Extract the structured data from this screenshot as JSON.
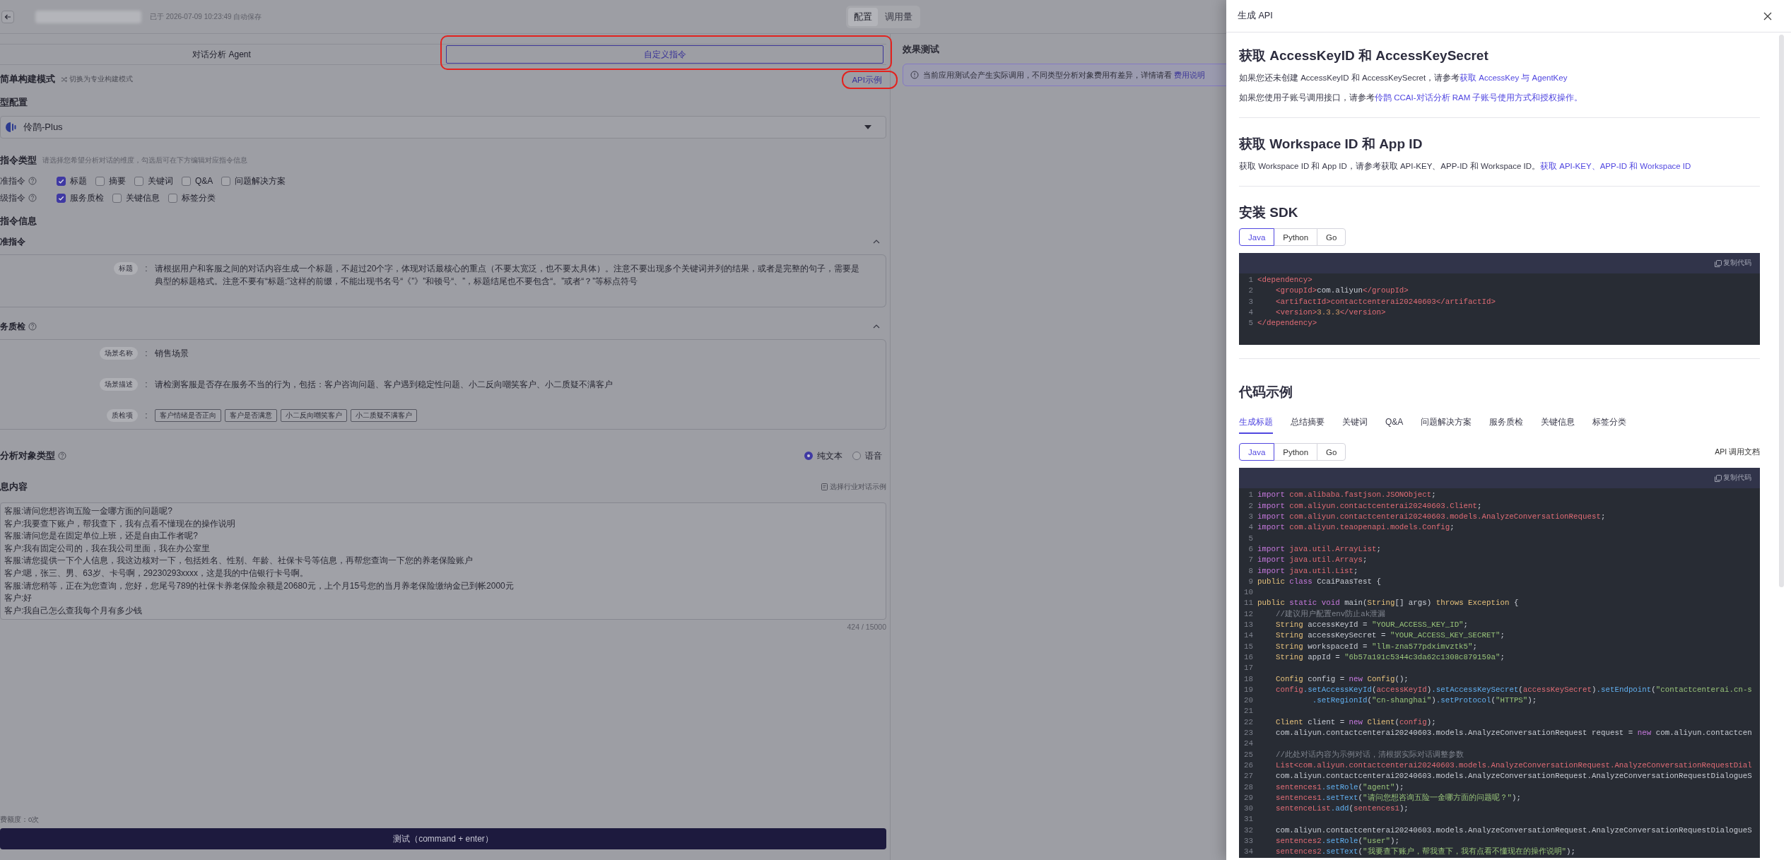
{
  "header": {
    "saved_note": "已于 2026-07-09 10:23:49 自动保存",
    "view_switch": [
      {
        "label": "配置",
        "selected": true
      },
      {
        "label": "调用量",
        "selected": false
      }
    ]
  },
  "mode_tabs": [
    {
      "label": "对话分析 Agent",
      "selected": false,
      "annotated": false
    },
    {
      "label": "自定义指令",
      "selected": true,
      "annotated": true
    }
  ],
  "build_mode": {
    "title": "简单构建模式",
    "switch_link": "切换为专业构建模式",
    "api_link": {
      "label": "API示例",
      "annotated": true
    }
  },
  "model_config": {
    "title": "型配置",
    "model": "伶鹊-Plus"
  },
  "instruction_types": {
    "title": "指令类型",
    "hint": "请选择您希望分析对话的维度，勾选后可在下方编辑对应指令信息",
    "groups": [
      {
        "label": "准指令",
        "options": [
          {
            "label": "标题",
            "checked": true
          },
          {
            "label": "摘要",
            "checked": false
          },
          {
            "label": "关键词",
            "checked": false
          },
          {
            "label": "Q&A",
            "checked": false
          },
          {
            "label": "问题解决方案",
            "checked": false
          }
        ]
      },
      {
        "label": "级指令",
        "options": [
          {
            "label": "服务质检",
            "checked": true
          },
          {
            "label": "关键信息",
            "checked": false
          },
          {
            "label": "标签分类",
            "checked": false
          }
        ]
      }
    ]
  },
  "instruction_info": {
    "title": "指令信息",
    "sections": [
      {
        "title": "准指令",
        "help": false,
        "expanded": true,
        "fields": [
          {
            "kind": "text",
            "label": "标题",
            "separator": ":",
            "text": "请根据用户和客服之间的对话内容生成一个标题，不超过20个字，体现对话最核心的重点（不要太宽泛，也不要太具体）。注意不要出现多个关键词并列的结果，或者是完整的句子，需要是典型的标题格式。注意不要有“标题:”这样的前缀，不能出现书名号“《”》”和顿号“、”，标题结尾也不要包含“。”或者“？”等标点符号"
          }
        ]
      },
      {
        "title": "务质检",
        "help": true,
        "expanded": true,
        "fields": [
          {
            "kind": "text",
            "label": "场景名称",
            "separator": ":",
            "text": "销售场景"
          },
          {
            "kind": "text",
            "label": "场景描述",
            "separator": ":",
            "text": "请检测客服是否存在服务不当的行为，包括：客户咨询问题、客户遇到稳定性问题、小二反向嘲笑客户、小二质疑不满客户"
          },
          {
            "kind": "tags",
            "label": "质检项",
            "separator": ":",
            "tags": [
              "客户情绪是否正向",
              "客户是否满意",
              "小二反向嘲笑客户",
              "小二质疑不满客户"
            ]
          }
        ]
      }
    ]
  },
  "analysis_type": {
    "title": "分析对象类型",
    "options": [
      {
        "label": "纯文本",
        "selected": true
      },
      {
        "label": "语音",
        "selected": false
      }
    ]
  },
  "message": {
    "title": "息内容",
    "example_link": "选择行业对话示例",
    "lines": [
      "客服:请问您想咨询五险一金哪方面的问题呢?",
      "客户:我要查下账户，帮我查下，我有点看不懂现在的操作说明",
      "客服:请问您是在固定单位上班，还是自由工作者呢?",
      "客户:我有固定公司的，我在我公司里面，我在办公室里",
      "客服:请您提供一下个人信息，我这边核对一下，包括姓名、性别、年龄、社保卡号等信息，再帮您查询一下您的养老保险账户",
      "客户:嗯，张三、男、63岁、卡号啊，29230293xxxx，这是我的中信银行卡号啊。",
      "客服:请您稍等，正在为您查询，您好，您尾号789的社保卡养老保险余额是20680元，上个月15号您的当月养老保险缴纳金已到帐2000元",
      "客户:好",
      "客户:我自己怎么查我每个月有多少钱"
    ],
    "counter": "424 / 15000"
  },
  "quota": "费额度：0次",
  "test_button": "测试（command + enter）",
  "test_panel": {
    "title": "效果测试",
    "notice": "当前应用测试会产生实际调用，不同类型分析对象费用有差异，详情请看 ",
    "notice_link": "费用说明"
  },
  "drawer": {
    "title": "生成 API",
    "sections": [
      {
        "kind": "text",
        "title": "获取 AccessKeyID 和 AccessKeySecret",
        "paragraphs": [
          {
            "text": "如果您还未创建 AccessKeyID 和 AccessKeySecret，请参考",
            "link": "获取 AccessKey 与 AgentKey"
          },
          {
            "text": "如果您使用子账号调用接口，请参考",
            "link": "伶鹊 CCAI-对话分析 RAM 子账号使用方式和授权操作。"
          }
        ]
      },
      {
        "kind": "text",
        "title": "获取 Workspace ID 和 App ID",
        "paragraphs": [
          {
            "text": "获取 Workspace ID 和 App ID，请参考获取 API-KEY、APP-ID 和 Workspace ID。",
            "link": "获取 API-KEY、APP-ID 和 Workspace ID"
          }
        ]
      },
      {
        "kind": "code",
        "title": "安装 SDK",
        "languages": [
          {
            "label": "Java",
            "selected": true
          },
          {
            "label": "Python",
            "selected": false
          },
          {
            "label": "Go",
            "selected": false
          }
        ],
        "copy_label": "复制代码",
        "lines": [
          {
            "no": "1",
            "segs": [
              {
                "kind": "tag",
                "text": "<dependency>"
              }
            ]
          },
          {
            "no": "2",
            "segs": [
              {
                "kind": "tag",
                "text": "    <groupId>"
              },
              {
                "kind": "plain",
                "text": "com.aliyun"
              },
              {
                "kind": "tag",
                "text": "</groupId>"
              }
            ]
          },
          {
            "no": "3",
            "segs": [
              {
                "kind": "tag",
                "text": "    <artifactId>"
              },
              {
                "kind": "ident",
                "text": "contactcenterai20240603"
              },
              {
                "kind": "tag",
                "text": "</artifactId>"
              }
            ]
          },
          {
            "no": "4",
            "segs": [
              {
                "kind": "tag",
                "text": "    <version>"
              },
              {
                "kind": "number",
                "text": "3.3.3"
              },
              {
                "kind": "tag",
                "text": "</version>"
              }
            ]
          },
          {
            "no": "5",
            "segs": [
              {
                "kind": "tag",
                "text": "</dependency>"
              }
            ]
          }
        ]
      },
      {
        "kind": "code",
        "title": "代码示例",
        "tabs": [
          {
            "label": "生成标题",
            "selected": true
          },
          {
            "label": "总结摘要",
            "selected": false
          },
          {
            "label": "关键词",
            "selected": false
          },
          {
            "label": "Q&A",
            "selected": false
          },
          {
            "label": "问题解决方案",
            "selected": false
          },
          {
            "label": "服务质检",
            "selected": false
          },
          {
            "label": "关键信息",
            "selected": false
          },
          {
            "label": "标签分类",
            "selected": false
          }
        ],
        "languages": [
          {
            "label": "Java",
            "selected": true
          },
          {
            "label": "Python",
            "selected": false
          },
          {
            "label": "Go",
            "selected": false
          }
        ],
        "doc_link": "API 调用文档",
        "copy_label": "复制代码",
        "lines": [
          {
            "no": "1",
            "segs": [
              {
                "kind": "keyword",
                "text": "import "
              },
              {
                "kind": "ident",
                "text": "com.alibaba.fastjson.JSONObject"
              },
              {
                "kind": "plain",
                "text": ";"
              }
            ]
          },
          {
            "no": "2",
            "segs": [
              {
                "kind": "keyword",
                "text": "import "
              },
              {
                "kind": "ident",
                "text": "com.aliyun.contactcenterai20240603.Client"
              },
              {
                "kind": "plain",
                "text": ";"
              }
            ]
          },
          {
            "no": "3",
            "segs": [
              {
                "kind": "keyword",
                "text": "import "
              },
              {
                "kind": "ident",
                "text": "com.aliyun.contactcenterai20240603.models.AnalyzeConversationRequest"
              },
              {
                "kind": "plain",
                "text": ";"
              }
            ]
          },
          {
            "no": "4",
            "segs": [
              {
                "kind": "keyword",
                "text": "import "
              },
              {
                "kind": "ident",
                "text": "com.aliyun.teaopenapi.models.Config"
              },
              {
                "kind": "plain",
                "text": ";"
              }
            ]
          },
          {
            "no": "5"
          },
          {
            "no": "6",
            "segs": [
              {
                "kind": "keyword",
                "text": "import "
              },
              {
                "kind": "ident",
                "text": "java.util.ArrayList"
              },
              {
                "kind": "plain",
                "text": ";"
              }
            ]
          },
          {
            "no": "7",
            "segs": [
              {
                "kind": "keyword",
                "text": "import "
              },
              {
                "kind": "ident",
                "text": "java.util.Arrays"
              },
              {
                "kind": "plain",
                "text": ";"
              }
            ]
          },
          {
            "no": "8",
            "segs": [
              {
                "kind": "keyword",
                "text": "import "
              },
              {
                "kind": "ident",
                "text": "java.util.List"
              },
              {
                "kind": "plain",
                "text": ";"
              }
            ]
          },
          {
            "no": "9",
            "segs": [
              {
                "kind": "type",
                "text": "public "
              },
              {
                "kind": "keyword",
                "text": "class "
              },
              {
                "kind": "plain",
                "text": "CcaiPaasTest {"
              }
            ]
          },
          {
            "no": "10"
          },
          {
            "no": "11",
            "segs": [
              {
                "kind": "type",
                "text": "public "
              },
              {
                "kind": "keyword",
                "text": "static void "
              },
              {
                "kind": "plain",
                "text": "main("
              },
              {
                "kind": "type",
                "text": "String"
              },
              {
                "kind": "plain",
                "text": "[] args) "
              },
              {
                "kind": "type",
                "text": "throws Exception"
              },
              {
                "kind": "plain",
                "text": " {"
              }
            ]
          },
          {
            "no": "12",
            "segs": [
              {
                "kind": "comment",
                "text": "    //建议用户配置env防止ak泄漏"
              }
            ]
          },
          {
            "no": "13",
            "segs": [
              {
                "kind": "type",
                "text": "    String"
              },
              {
                "kind": "plain",
                "text": " accessKeyId = "
              },
              {
                "kind": "string",
                "text": "\"YOUR_ACCESS_KEY_ID\""
              },
              {
                "kind": "plain",
                "text": ";"
              }
            ]
          },
          {
            "no": "14",
            "segs": [
              {
                "kind": "type",
                "text": "    String"
              },
              {
                "kind": "plain",
                "text": " accessKeySecret = "
              },
              {
                "kind": "string",
                "text": "\"YOUR_ACCESS_KEY_SECRET\""
              },
              {
                "kind": "plain",
                "text": ";"
              }
            ]
          },
          {
            "no": "15",
            "segs": [
              {
                "kind": "type",
                "text": "    String"
              },
              {
                "kind": "plain",
                "text": " workspaceId = "
              },
              {
                "kind": "string",
                "text": "\"llm-zna577pdximvztk5\""
              },
              {
                "kind": "plain",
                "text": ";"
              }
            ]
          },
          {
            "no": "16",
            "segs": [
              {
                "kind": "type",
                "text": "    String"
              },
              {
                "kind": "plain",
                "text": " appId = "
              },
              {
                "kind": "string",
                "text": "\"6b57a191c5344c3da62c1308c879159a\""
              },
              {
                "kind": "plain",
                "text": ";"
              }
            ]
          },
          {
            "no": "17"
          },
          {
            "no": "18",
            "segs": [
              {
                "kind": "type",
                "text": "    Config"
              },
              {
                "kind": "plain",
                "text": " config = "
              },
              {
                "kind": "keyword",
                "text": "new "
              },
              {
                "kind": "type",
                "text": "Config"
              },
              {
                "kind": "plain",
                "text": "();"
              }
            ]
          },
          {
            "no": "19",
            "segs": [
              {
                "kind": "ident",
                "text": "    config"
              },
              {
                "kind": "func",
                "text": ".setAccessKeyId"
              },
              {
                "kind": "plain",
                "text": "("
              },
              {
                "kind": "ident",
                "text": "accessKeyId"
              },
              {
                "kind": "plain",
                "text": ")"
              },
              {
                "kind": "func",
                "text": ".setAccessKeySecret"
              },
              {
                "kind": "plain",
                "text": "("
              },
              {
                "kind": "ident",
                "text": "accessKeySecret"
              },
              {
                "kind": "plain",
                "text": ")"
              },
              {
                "kind": "func",
                "text": ".setEndpoint"
              },
              {
                "kind": "plain",
                "text": "("
              },
              {
                "kind": "string",
                "text": "\"contactcenterai.cn-s"
              }
            ]
          },
          {
            "no": "20",
            "segs": [
              {
                "kind": "func",
                "text": "            .setRegionId"
              },
              {
                "kind": "plain",
                "text": "("
              },
              {
                "kind": "string",
                "text": "\"cn-shanghai\""
              },
              {
                "kind": "plain",
                "text": ")"
              },
              {
                "kind": "func",
                "text": ".setProtocol"
              },
              {
                "kind": "plain",
                "text": "("
              },
              {
                "kind": "string",
                "text": "\"HTTPS\""
              },
              {
                "kind": "plain",
                "text": ");"
              }
            ]
          },
          {
            "no": "21"
          },
          {
            "no": "22",
            "segs": [
              {
                "kind": "type",
                "text": "    Client"
              },
              {
                "kind": "plain",
                "text": " client = "
              },
              {
                "kind": "keyword",
                "text": "new "
              },
              {
                "kind": "type",
                "text": "Client"
              },
              {
                "kind": "plain",
                "text": "("
              },
              {
                "kind": "ident",
                "text": "config"
              },
              {
                "kind": "plain",
                "text": ");"
              }
            ]
          },
          {
            "no": "23",
            "segs": [
              {
                "kind": "plain",
                "text": "    com.aliyun.contactcenterai20240603.models.AnalyzeConversationRequest request = "
              },
              {
                "kind": "keyword",
                "text": "new "
              },
              {
                "kind": "plain",
                "text": "com.aliyun.contactcen"
              }
            ]
          },
          {
            "no": "24"
          },
          {
            "no": "25",
            "segs": [
              {
                "kind": "comment",
                "text": "    //此处对话内容为示例对话，清根据实际对话调整参数"
              }
            ]
          },
          {
            "no": "26",
            "segs": [
              {
                "kind": "ident",
                "text": "    List<com.aliyun.contactcenterai20240603.models.AnalyzeConversationRequest.AnalyzeConversationRequestDial"
              }
            ]
          },
          {
            "no": "27",
            "segs": [
              {
                "kind": "plain",
                "text": "    com.aliyun.contactcenterai20240603.models.AnalyzeConversationRequest.AnalyzeConversationRequestDialogueS"
              }
            ]
          },
          {
            "no": "28",
            "segs": [
              {
                "kind": "ident",
                "text": "    sentences1"
              },
              {
                "kind": "func",
                "text": ".setRole"
              },
              {
                "kind": "plain",
                "text": "("
              },
              {
                "kind": "string",
                "text": "\"agent\""
              },
              {
                "kind": "plain",
                "text": ");"
              }
            ]
          },
          {
            "no": "29",
            "segs": [
              {
                "kind": "ident",
                "text": "    sentences1"
              },
              {
                "kind": "func",
                "text": ".setText"
              },
              {
                "kind": "plain",
                "text": "("
              },
              {
                "kind": "string",
                "text": "\"请问您想咨询五险一金哪方面的问题呢？\""
              },
              {
                "kind": "plain",
                "text": ");"
              }
            ]
          },
          {
            "no": "30",
            "segs": [
              {
                "kind": "ident",
                "text": "    sentenceList"
              },
              {
                "kind": "func",
                "text": ".add"
              },
              {
                "kind": "plain",
                "text": "("
              },
              {
                "kind": "ident",
                "text": "sentences1"
              },
              {
                "kind": "plain",
                "text": ");"
              }
            ]
          },
          {
            "no": "31"
          },
          {
            "no": "32",
            "segs": [
              {
                "kind": "plain",
                "text": "    com.aliyun.contactcenterai20240603.models.AnalyzeConversationRequest.AnalyzeConversationRequestDialogueS"
              }
            ]
          },
          {
            "no": "33",
            "segs": [
              {
                "kind": "ident",
                "text": "    sentences2"
              },
              {
                "kind": "func",
                "text": ".setRole"
              },
              {
                "kind": "plain",
                "text": "("
              },
              {
                "kind": "string",
                "text": "\"user\""
              },
              {
                "kind": "plain",
                "text": ");"
              }
            ]
          },
          {
            "no": "34",
            "segs": [
              {
                "kind": "ident",
                "text": "    sentences2"
              },
              {
                "kind": "func",
                "text": ".setText"
              },
              {
                "kind": "plain",
                "text": "("
              },
              {
                "kind": "string",
                "text": "\"我要查下账户，帮我查下，我有点看不懂现在的操作说明\""
              },
              {
                "kind": "plain",
                "text": ");"
              }
            ]
          }
        ]
      }
    ]
  }
}
